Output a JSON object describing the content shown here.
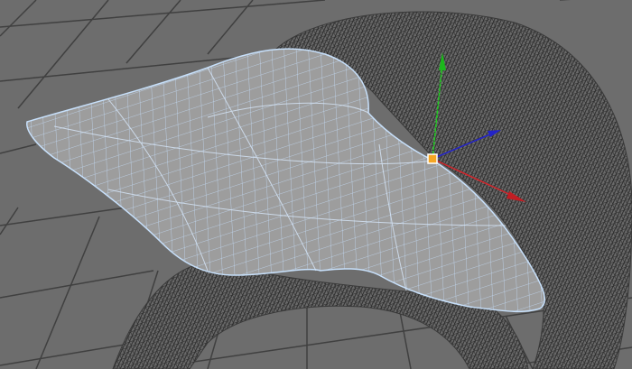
{
  "viewport": {
    "background_color": "#6d6d6d",
    "grid_line_color": "#3e3e3e",
    "mesh_color": "#2f2f2f",
    "surface_color": "#9c9c9c",
    "surface_wire_color": "#a9cdf5",
    "gizmo": {
      "icon": "move-manipulator-icon",
      "x_axis_color": "#d0242a",
      "y_axis_color": "#1fd11f",
      "z_axis_color": "#2323c8",
      "pivot_color": "#f5a623"
    }
  }
}
